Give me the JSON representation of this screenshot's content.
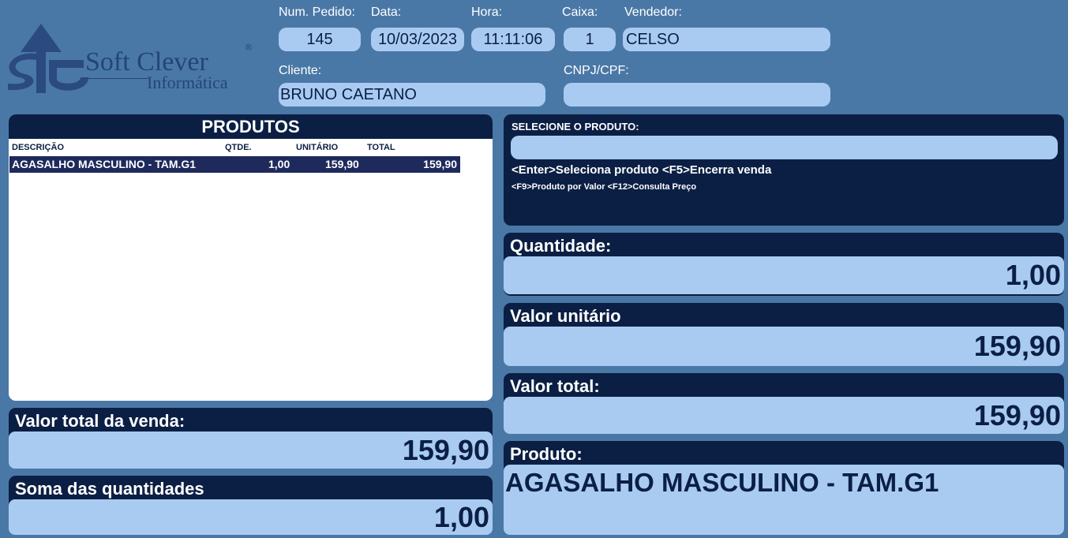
{
  "logo": {
    "name": "Soft Clever",
    "sub": "Informática",
    "reg": "®"
  },
  "header": {
    "pedido_label": "Num. Pedido:",
    "pedido": "145",
    "data_label": "Data:",
    "data": "10/03/2023",
    "hora_label": "Hora:",
    "hora": "11:11:06",
    "caixa_label": "Caixa:",
    "caixa": "1",
    "vendedor_label": "Vendedor:",
    "vendedor": "CELSO",
    "cliente_label": "Cliente:",
    "cliente": "BRUNO CAETANO",
    "cnpj_label": "CNPJ/CPF:",
    "cnpj": ""
  },
  "produtos": {
    "title": "PRODUTOS",
    "columns": [
      "DESCRIÇÃO",
      "QTDE.",
      "UNITÁRIO",
      "TOTAL"
    ],
    "rows": [
      {
        "descricao": "AGASALHO MASCULINO - TAM.G1",
        "qtde": "1,00",
        "unitario": "159,90",
        "total": "159,90"
      }
    ]
  },
  "select": {
    "label": "SELECIONE O PRODUTO:",
    "value": "",
    "hint1": "<Enter>Seleciona produto <F5>Encerra venda",
    "hint2": "<F9>Produto por Valor <F12>Consulta Preço"
  },
  "quantidade": {
    "label": "Quantidade:",
    "value": "1,00"
  },
  "valor_unitario": {
    "label": "Valor unitário",
    "value": "159,90"
  },
  "valor_total": {
    "label": "Valor total:",
    "value": "159,90"
  },
  "produto": {
    "label": "Produto:",
    "value": "AGASALHO MASCULINO - TAM.G1"
  },
  "venda_total": {
    "label": "Valor total da venda:",
    "value": "159,90"
  },
  "soma_qtd": {
    "label": "Soma das quantidades",
    "value": "1,00"
  },
  "colors": {
    "background": "#4a78a6",
    "dark": "#0b1f44",
    "field": "#a9cbf2",
    "row": "#1f2a5c"
  }
}
